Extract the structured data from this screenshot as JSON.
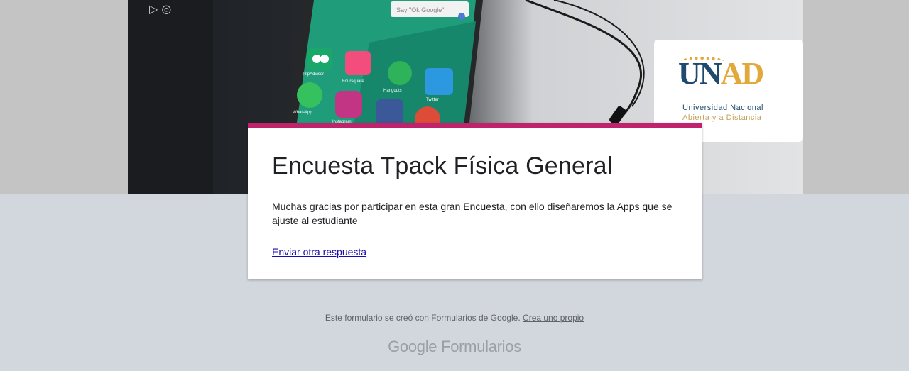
{
  "header": {
    "photo_app_labels": [
      "TripAdvisor",
      "Foursquare",
      "Hangouts",
      "Twitter",
      "WhatsApp",
      "Instagram"
    ],
    "search_hint": "Say \"Ok Google\"",
    "logo": {
      "word_part1": "UN",
      "word_part2": "AD",
      "line1": "Universidad Nacional",
      "line2": "Abierta y a Distancia"
    }
  },
  "card": {
    "accent_color": "#c0226b",
    "title": "Encuesta Tpack Física General",
    "message": "Muchas gracias por participar en esta gran Encuesta, con ello diseñaremos la Apps que se ajuste al estudiante",
    "link": "Enviar otra respuesta"
  },
  "footer": {
    "note": "Este formulario se creó con Formularios de Google.",
    "link": "Crea uno propio",
    "brand_google": "Google",
    "brand_product": "Formularios"
  }
}
